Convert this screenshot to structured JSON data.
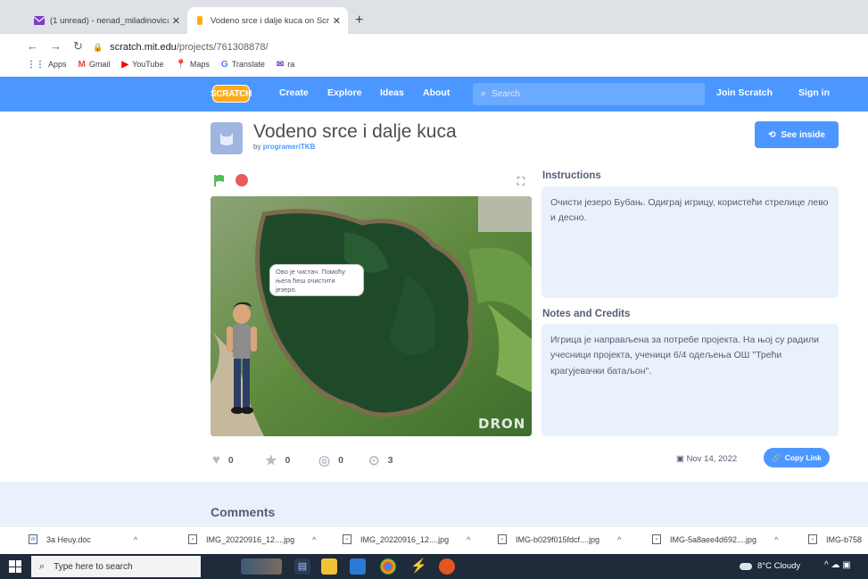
{
  "browser": {
    "tabs": [
      {
        "title": "(1 unread) - nenad_miladinovic@",
        "icon": "mail-icon"
      },
      {
        "title": "Vodeno srce i dalje kuca on Scrat",
        "icon": "scratch-tab-icon"
      }
    ],
    "new_tab": "+",
    "url_host": "scratch.mit.edu",
    "url_path": "/projects/761308878/",
    "bookmarks": [
      {
        "label": "Apps",
        "icon": "apps-grid-icon"
      },
      {
        "label": "Gmail",
        "icon": "gmail-icon"
      },
      {
        "label": "YouTube",
        "icon": "youtube-icon"
      },
      {
        "label": "Maps",
        "icon": "maps-icon"
      },
      {
        "label": "Translate",
        "icon": "translate-icon"
      },
      {
        "label": "ra",
        "icon": "mail-icon"
      }
    ]
  },
  "scratch_nav": {
    "logo": "SCRATCH",
    "create": "Create",
    "explore": "Explore",
    "ideas": "Ideas",
    "about": "About",
    "search_placeholder": "Search",
    "join": "Join Scratch",
    "signin": "Sign in"
  },
  "project": {
    "title": "Vodeno srce i dalje kuca",
    "by_prefix": "by",
    "author": "programeriTKB",
    "see_inside": "See inside",
    "speech_bubble": "Ово је чистач. Помоћу њега ћеш очистити језеро.",
    "stage_watermark": "DRON",
    "instructions_heading": "Instructions",
    "instructions_text": "Очисти језеро Бубањ. Одиграј игрицу, користећи стрелице лево и десно.",
    "notes_heading": "Notes and Credits",
    "notes_text": "Игрица је направљена за потребе пројекта. На њој су радили учесници пројекта, ученици 6/4 одељења ОШ \"Трећи крагујевачки батаљон\".",
    "stats": {
      "loves": "0",
      "favorites": "0",
      "remixes": "0",
      "views": "3"
    },
    "date": "Nov 14, 2022",
    "copy_link": "Copy Link",
    "comments_heading": "Comments"
  },
  "downloads": [
    {
      "name": "3a Heuy.doc"
    },
    {
      "name": "IMG_20220916_12....jpg"
    },
    {
      "name": "IMG_20220916_12....jpg"
    },
    {
      "name": "IMG-b029f015fdcf....jpg"
    },
    {
      "name": "IMG-5a8aee4d692....jpg"
    },
    {
      "name": "IMG-b758"
    }
  ],
  "taskbar": {
    "search_placeholder": "Type here to search",
    "weather": "8°C  Cloudy"
  },
  "colors": {
    "scratch_blue": "#4c97ff",
    "scratch_orange": "#ffab19",
    "panel_bg": "#e9f1fc",
    "stop_red": "#ec5959"
  }
}
